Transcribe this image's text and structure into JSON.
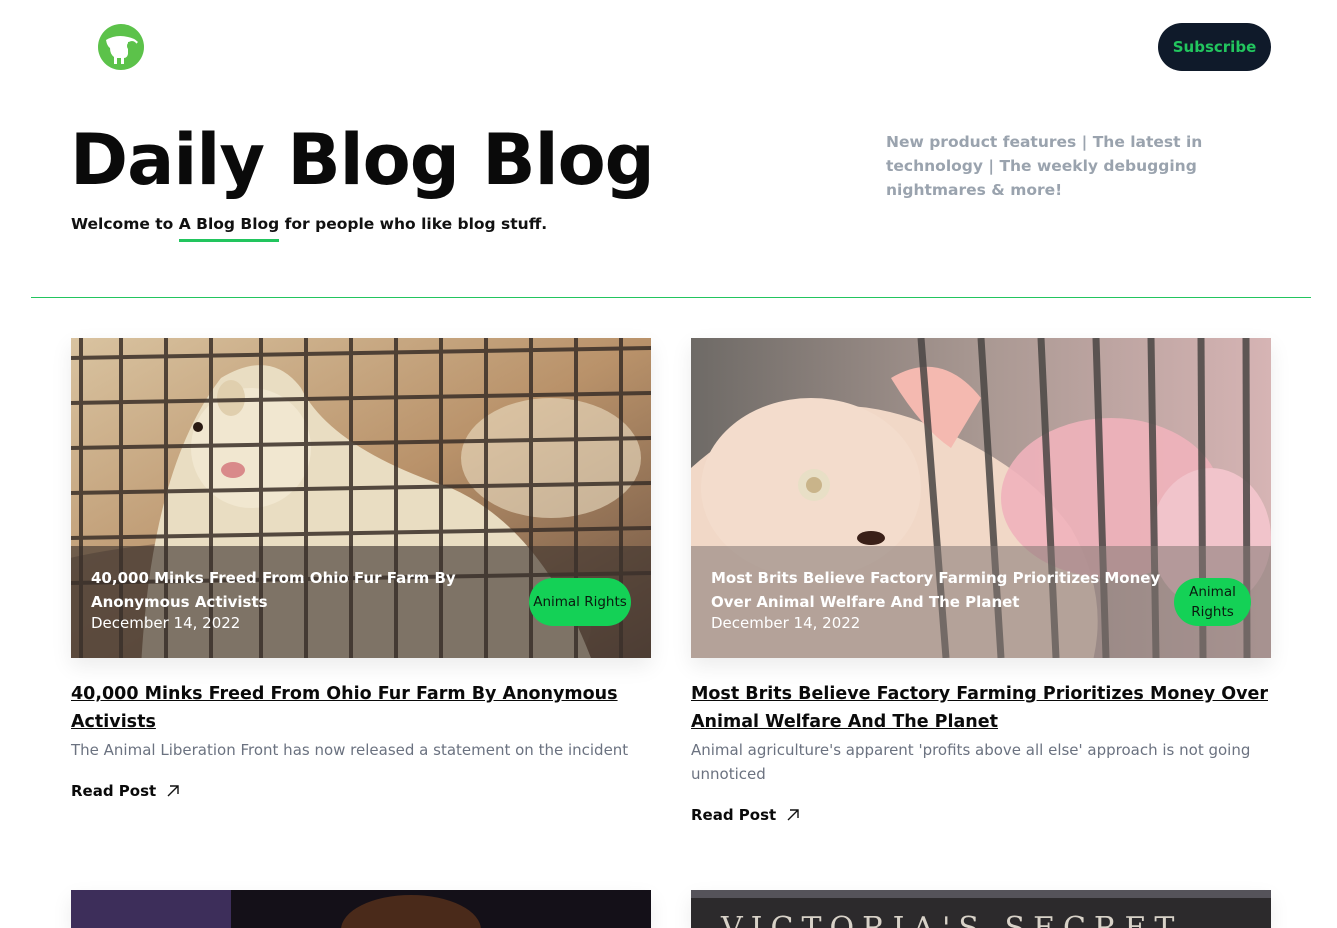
{
  "header": {
    "logo_icon": "cow-logo-icon",
    "subscribe_label": "Subscribe",
    "accent_color": "#22c55e",
    "dark_color": "#0f1a2a"
  },
  "hero": {
    "title": "Daily Blog Blog",
    "tagline_prefix": "Welcome to ",
    "tagline_highlight": "A Blog Blog",
    "tagline_suffix": " for people who like blog stuff.",
    "side_note": "New product features | The latest in technology | The weekly debugging nightmares & more!"
  },
  "posts": [
    {
      "overlay_title": "40,000 Minks Freed From Ohio Fur Farm By Anonymous Activists",
      "date": "December 14, 2022",
      "category": "Animal Rights",
      "title": "40,000 Minks Freed From Ohio Fur Farm By Anonymous Activists",
      "description": "The Animal Liberation Front has now released a statement on the incident",
      "read_label": "Read Post"
    },
    {
      "overlay_title": "Most Brits Believe Factory Farming Prioritizes Money Over Animal Welfare And The Planet",
      "date": "December 14, 2022",
      "category": "Animal Rights",
      "title": "Most Brits Believe Factory Farming Prioritizes Money Over Animal Welfare And The Planet",
      "description": "Animal agriculture's apparent 'profits above all else' approach is not going unnoticed",
      "read_label": "Read Post"
    }
  ]
}
